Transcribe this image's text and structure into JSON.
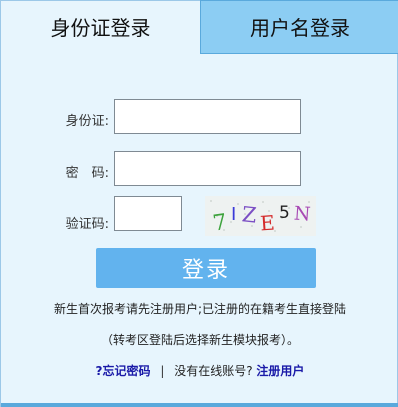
{
  "tabs": {
    "id_login": "身份证登录",
    "username_login": "用户名登录"
  },
  "form": {
    "id_label": "身份证:",
    "password_label": "密　码:",
    "captcha_label": "验证码:",
    "id_value": "",
    "password_value": "",
    "captcha_value": "",
    "captcha_text": "7IZE5N",
    "login_button": "登录"
  },
  "notes": {
    "line1": "新生首次报考请先注册用户;已注册的在籍考生直接登陆",
    "line2": "（转考区登陆后选择新生模块报考）。"
  },
  "links": {
    "forgot_password": "?忘记密码",
    "separator": "|",
    "no_account": "没有在线账号?",
    "register": "注册用户"
  },
  "colors": {
    "panel_bg": "#e7f5fd",
    "inactive_tab": "#8ccdf3",
    "button": "#62b3ee",
    "link": "#1a1aa8"
  }
}
